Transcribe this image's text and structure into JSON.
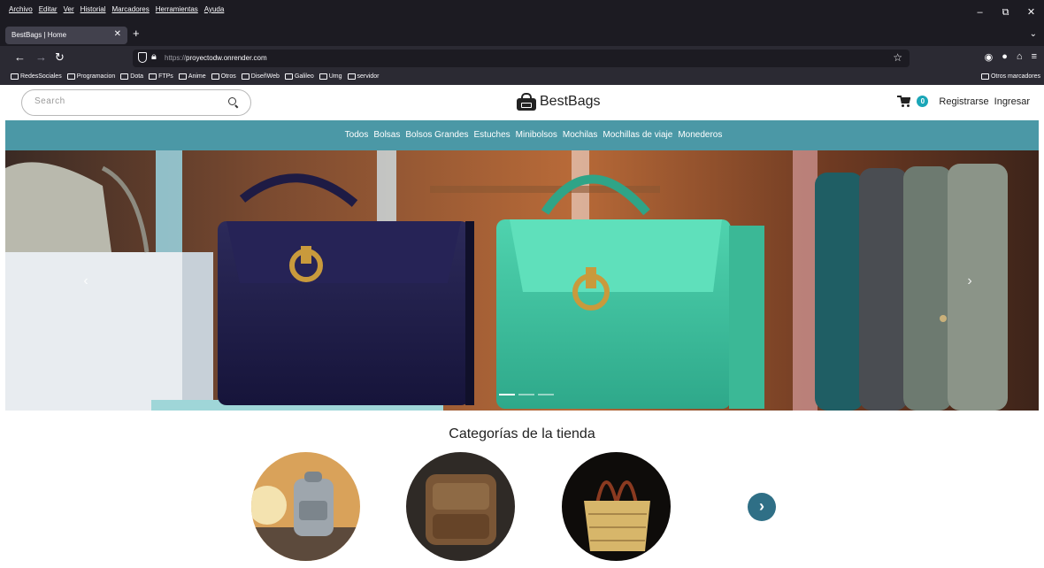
{
  "browser": {
    "menu": [
      "Archivo",
      "Editar",
      "Ver",
      "Historial",
      "Marcadores",
      "Herramientas",
      "Ayuda"
    ],
    "window_controls": [
      "–",
      "⧉",
      "✕"
    ],
    "tab_title": "BestBags | Home",
    "tab_close": "✕",
    "new_tab": "+",
    "tab_list": "⌄",
    "nav": {
      "back": "←",
      "forward": "→",
      "reload": "↻"
    },
    "url_protocol": "https://",
    "url_host": "proyectodw.onrender.com",
    "bookmarks": [
      "RedesSociales",
      "Programacion",
      "Dota",
      "FTPs",
      "Anime",
      "Otros",
      "DiseñWeb",
      "Galileo",
      "Umg",
      "servidor"
    ],
    "other_bookmarks": "Otros marcadores"
  },
  "header": {
    "search_placeholder": "Search",
    "brand_name": "BestBags",
    "cart_count": "0",
    "register_label": "Registrarse",
    "login_label": "Ingresar"
  },
  "nav": {
    "categories": [
      "Todos",
      "Bolsas",
      "Bolsos Grandes",
      "Estuches",
      "Minibolsos",
      "Mochilas",
      "Mochillas de viaje",
      "Monederos"
    ]
  },
  "carousel": {
    "prev": "‹",
    "next": "›",
    "slide_count": 3,
    "active_index": 0
  },
  "section": {
    "categories_title": "Categorías de la tienda",
    "next": "›"
  },
  "colors": {
    "nav_bg": "#4b98a6",
    "badge": "#1aa6b7",
    "next_circle": "#2f6f86"
  }
}
